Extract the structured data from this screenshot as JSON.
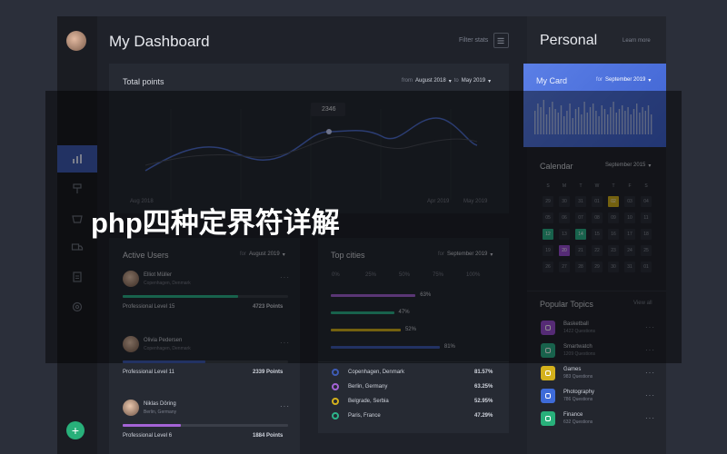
{
  "dashboard": {
    "title": "My Dashboard",
    "filter_label": "Filter stats"
  },
  "total_points": {
    "title": "Total points",
    "from_label": "from",
    "from_value": "August 2018",
    "to_label": "to",
    "to_value": "May 2019",
    "tooltip_value": "2346",
    "x_labels": [
      "Aug 2018",
      "Apr 2019",
      "May 2019"
    ]
  },
  "active_users": {
    "title": "Active Users",
    "for_label": "for",
    "for_value": "August 2019",
    "users": [
      {
        "name": "Elliot Müller",
        "location": "Copenhagen, Denmark",
        "level": "Professional Level 15",
        "points": "4723 Points",
        "progress": 0.7,
        "color": "#2db38a"
      },
      {
        "name": "Olivia Pedersen",
        "location": "Copenhagen, Denmark",
        "level": "Professional Level 11",
        "points": "2339 Points",
        "progress": 0.5,
        "color": "#3e5bb4"
      },
      {
        "name": "Niklas Döring",
        "location": "Berlin, Germany",
        "level": "Professional Level 6",
        "points": "1884 Points",
        "progress": 0.35,
        "color": "#a463d6"
      }
    ]
  },
  "top_cities": {
    "title": "Top cities",
    "for_label": "for",
    "for_value": "September 2019",
    "axis": [
      "0%",
      "25%",
      "50%",
      "75%",
      "100%"
    ],
    "bars": [
      {
        "label": "63%",
        "value": 63,
        "color": "#a463d6"
      },
      {
        "label": "47%",
        "value": 47,
        "color": "#2db38a"
      },
      {
        "label": "52%",
        "value": 52,
        "color": "#d4b11c"
      },
      {
        "label": "81%",
        "value": 81,
        "color": "#3e5bb4"
      }
    ],
    "cities": [
      {
        "name": "Copenhagen, Denmark",
        "value": "81.57%",
        "color": "#3e5bb4"
      },
      {
        "name": "Berlin, Germany",
        "value": "63.25%",
        "color": "#a463d6"
      },
      {
        "name": "Belgrade, Serbia",
        "value": "52.95%",
        "color": "#d4b11c"
      },
      {
        "name": "Paris, France",
        "value": "47.29%",
        "color": "#2db38a"
      }
    ]
  },
  "personal": {
    "title": "Personal",
    "learn_more": "Learn more",
    "my_card": {
      "title": "My Card",
      "for_label": "for",
      "for_value": "September 2019"
    }
  },
  "calendar": {
    "title": "Calendar",
    "month": "September 2015",
    "weekdays": [
      "S",
      "M",
      "T",
      "W",
      "T",
      "F",
      "S"
    ],
    "days": [
      "29",
      "30",
      "31",
      "01",
      "02",
      "03",
      "04",
      "05",
      "06",
      "07",
      "08",
      "09",
      "10",
      "11",
      "12",
      "13",
      "14",
      "15",
      "16",
      "17",
      "18",
      "19",
      "20",
      "21",
      "22",
      "23",
      "24",
      "25",
      "26",
      "27",
      "28",
      "29",
      "30",
      "31",
      "01"
    ]
  },
  "popular_topics": {
    "title": "Popular Topics",
    "view_all": "View all",
    "topics": [
      {
        "name": "Basketball",
        "sub": "1422 Questions",
        "color": "#9b4fd6",
        "icon": "headphones-icon"
      },
      {
        "name": "Smartwatch",
        "sub": "1209 Questions",
        "color": "#2db38a",
        "icon": "watch-icon"
      },
      {
        "name": "Games",
        "sub": "983 Questions",
        "color": "#d4b11c",
        "icon": "controller-icon"
      },
      {
        "name": "Photography",
        "sub": "786 Questions",
        "color": "#3e6bd8",
        "icon": "camera-icon"
      },
      {
        "name": "Finance",
        "sub": "632 Questions",
        "color": "#28b07a",
        "icon": "money-icon"
      }
    ]
  },
  "overlay": {
    "title": "php四种定界符详解"
  },
  "fab": {
    "label": "+"
  }
}
